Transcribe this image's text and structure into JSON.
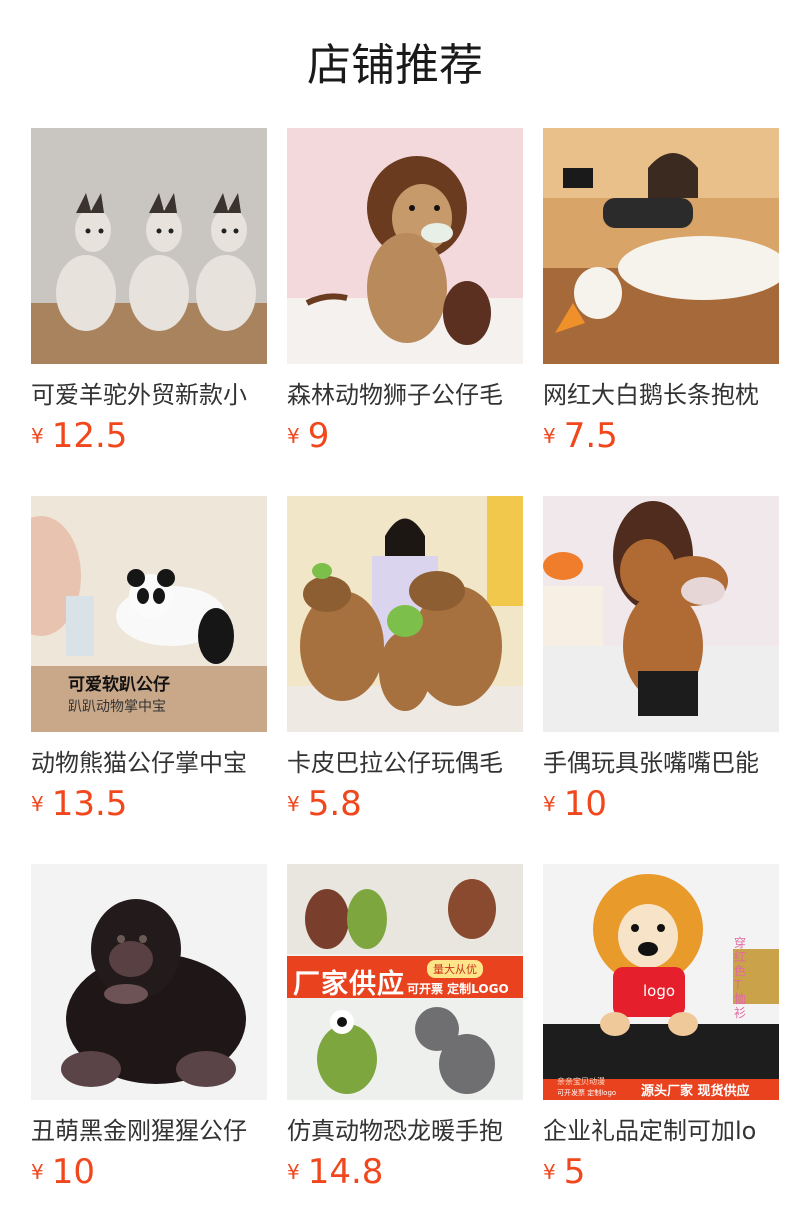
{
  "header": {
    "title": "店铺推荐"
  },
  "currency_symbol": "¥",
  "products": [
    {
      "name": "可爱羊驼外贸新款小",
      "price": "12.5",
      "image": "alpaca-plush-photo"
    },
    {
      "name": "森林动物狮子公仔毛",
      "price": "9",
      "image": "lion-plush-photo"
    },
    {
      "name": "网红大白鹅长条抱枕",
      "price": "7.5",
      "image": "goose-pillow-photo"
    },
    {
      "name": "动物熊猫公仔掌中宝",
      "price": "13.5",
      "image": "panda-plush-photo",
      "overlay": {
        "line1": "可爱软趴公仔",
        "line2": "趴趴动物掌中宝"
      }
    },
    {
      "name": "卡皮巴拉公仔玩偶毛",
      "price": "5.8",
      "image": "capybara-plush-photo"
    },
    {
      "name": "手偶玩具张嘴嘴巴能",
      "price": "10",
      "image": "lion-hand-puppet-photo"
    },
    {
      "name": "丑萌黑金刚猩猩公仔",
      "price": "10",
      "image": "gorilla-plush-photo"
    },
    {
      "name": "仿真动物恐龙暖手抱",
      "price": "14.8",
      "image": "dinosaur-plush-photo",
      "overlay": {
        "banner": "厂家供应",
        "tag1": "量大从优",
        "tag2": "可开票 定制LOGO"
      }
    },
    {
      "name": "企业礼品定制可加lo",
      "price": "5",
      "image": "lion-logo-plush-photo",
      "overlay": {
        "shirt": "logo",
        "side": "穿红色T恤衫",
        "footer_left": "亲亲宝贝动漫",
        "footer_sub": "可开发票 定制logo",
        "footer_right": "源头厂家 现货供应"
      }
    }
  ],
  "colors": {
    "price": "#f0471d",
    "title": "#1a1a1a",
    "name": "#333333"
  }
}
